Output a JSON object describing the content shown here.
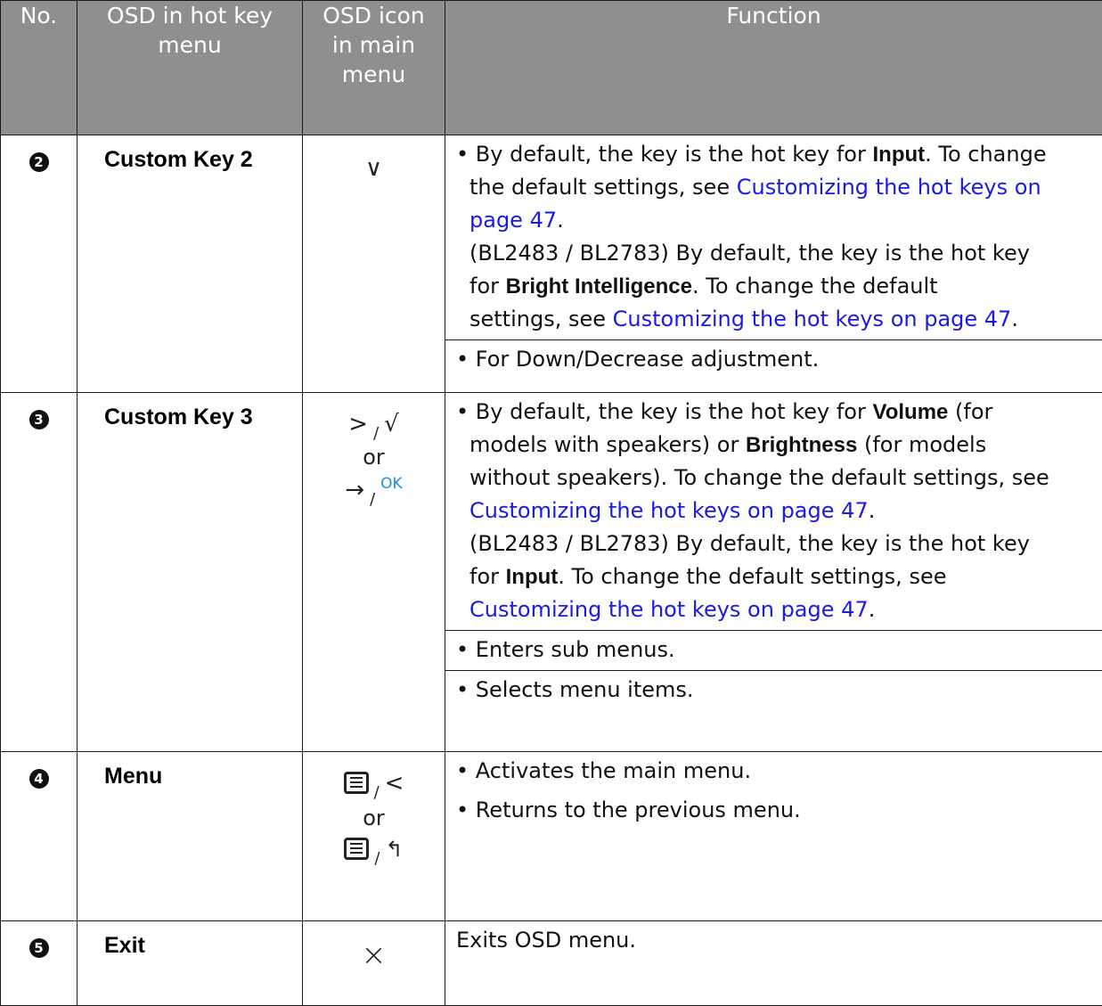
{
  "headers": {
    "no": "No.",
    "osd_line1": "OSD in hot key",
    "osd_line2": "menu",
    "icon_line1": "OSD icon",
    "icon_line2": "in main",
    "icon_line3": "menu",
    "function": "Function"
  },
  "rows": [
    {
      "no": "2",
      "name": "Custom Key 2",
      "icon": "chevron-down-icon",
      "icon_glyph": "∨",
      "func": {
        "a1": "By default, the key is the hot key for ",
        "a1b": "Input",
        "a1c": ". To change",
        "a2": "the default settings, see ",
        "a2l": "Customizing the hot keys on",
        "a3l": "page 47",
        "a3c": ".",
        "a4": "(BL2483 / BL2783) By default, the key is the hot key",
        "a5": "for ",
        "a5b": "Bright Intelligence",
        "a5c": ". To change the default",
        "a6": "settings, see ",
        "a6l": "Customizing the hot keys on page 47",
        "a6c": ".",
        "b1": "For Down/Decrease adjustment."
      }
    },
    {
      "no": "3",
      "name": "Custom Key 3",
      "icon_top_left": ">",
      "icon_top_right": "√",
      "or": "or",
      "icon_bottom_left": "→",
      "icon_bottom_right": "OK",
      "slash": "/",
      "func": {
        "a1": "By default, the key is the hot key for ",
        "a1b": "Volume",
        "a1c": " (for",
        "a2": "models with speakers) or ",
        "a2b": "Brightness",
        "a2c": " (for models",
        "a3": "without speakers). To change the default settings, see",
        "a4l": "Customizing the hot keys on page 47",
        "a4c": ".",
        "a5": "(BL2483 / BL2783) By default, the key is the hot key",
        "a6": "for ",
        "a6b": "Input",
        "a6c": ". To change the default settings, see",
        "a7l": "Customizing the hot keys on page 47",
        "a7c": ".",
        "b1": "Enters sub menus.",
        "c1": "Selects menu items."
      }
    },
    {
      "no": "4",
      "name": "Menu",
      "icon_top_right": "<",
      "or": "or",
      "icon_bottom_right": "↰",
      "slash": "/",
      "func": {
        "a1": "Activates the main menu.",
        "b1": "Returns to the previous menu."
      }
    },
    {
      "no": "5",
      "name": "Exit",
      "icon_glyph": "×",
      "func": {
        "a1": "Exits OSD menu."
      }
    }
  ],
  "bullet": "•",
  "colors": {
    "header_bg": "#8f8f8f",
    "link": "#1a1ae6",
    "ok": "#1a8fd6"
  }
}
